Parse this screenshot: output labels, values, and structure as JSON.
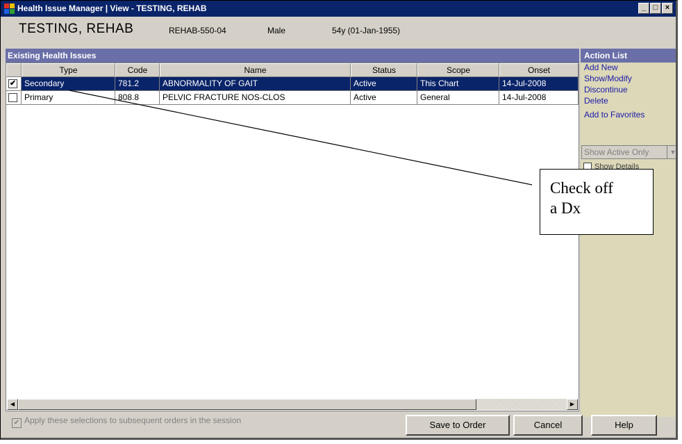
{
  "window": {
    "title": "Health Issue Manager | View - TESTING, REHAB",
    "minimize": "_",
    "maximize": "□",
    "close": "×"
  },
  "patient": {
    "name": "TESTING, REHAB",
    "mrn": "REHAB-550-04",
    "sex": "Male",
    "age": "54y (01-Jan-1955)"
  },
  "issues": {
    "header": "Existing Health Issues",
    "columns": [
      "Type",
      "Code",
      "Name",
      "Status",
      "Scope",
      "Onset"
    ],
    "rows": [
      {
        "checked": true,
        "type": "Secondary",
        "code": "781.2",
        "name": "ABNORMALITY OF GAIT",
        "status": "Active",
        "scope": "This Chart",
        "onset": "14-Jul-2008"
      },
      {
        "checked": false,
        "type": "Primary",
        "code": "808.8",
        "name": "PELVIC FRACTURE NOS-CLOS",
        "status": "Active",
        "scope": "General",
        "onset": "14-Jul-2008"
      }
    ]
  },
  "actions": {
    "title": "Action List",
    "links": [
      "Add New",
      "Show/Modify",
      "Discontinue",
      "Delete",
      "Add to Favorites"
    ],
    "filter_value": "Show Active Only",
    "show_details": "Show Details"
  },
  "footer": {
    "apply_label": "Apply these selections to subsequent orders in the session",
    "apply_checked": true,
    "save": "Save to Order",
    "cancel": "Cancel",
    "help": "Help"
  },
  "annotation": {
    "line1": "Check off",
    "line2": "a Dx"
  },
  "colors": {
    "titlebar": "#0a246a",
    "section_header": "#6a6fa8",
    "action_panel": "#dcd8b8",
    "link": "#1a1aa8"
  }
}
